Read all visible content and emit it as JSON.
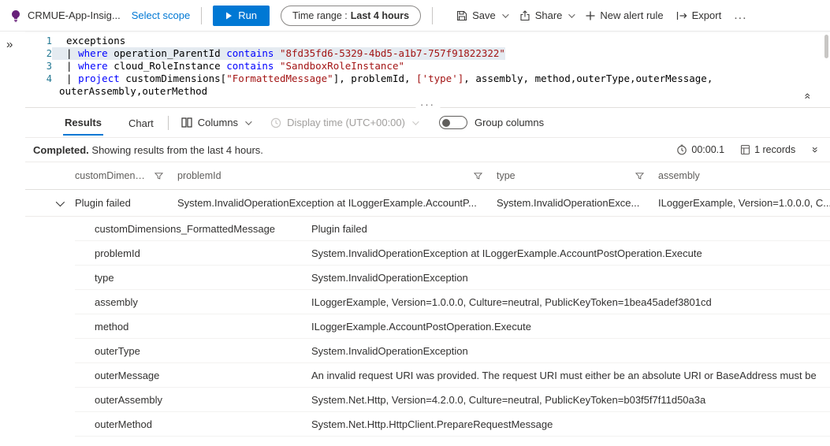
{
  "toolbar": {
    "app_name": "CRMUE-App-Insig...",
    "select_scope": "Select scope",
    "run": "Run",
    "time_range_label": "Time range :",
    "time_range_value": "Last 4 hours",
    "save": "Save",
    "share": "Share",
    "new_alert_rule": "New alert rule",
    "export": "Export",
    "more": "..."
  },
  "icons": {
    "run_play": "▶",
    "expand_rail": "»",
    "double_chevron": "»",
    "plus": "+"
  },
  "editor": {
    "lines": [
      {
        "num": "1",
        "tokens": [
          {
            "t": "exceptions",
            "c": "plain"
          }
        ]
      },
      {
        "num": "2",
        "highlight": true,
        "tokens": [
          {
            "t": "| ",
            "c": "plain"
          },
          {
            "t": "where",
            "c": "kw"
          },
          {
            "t": " operation_ParentId ",
            "c": "plain"
          },
          {
            "t": "contains",
            "c": "kw"
          },
          {
            "t": " ",
            "c": "plain"
          },
          {
            "t": "\"8fd35fd6-5329-4bd5-a1b7-757f91822322\"",
            "c": "str"
          }
        ]
      },
      {
        "num": "3",
        "tokens": [
          {
            "t": "| ",
            "c": "plain"
          },
          {
            "t": "where",
            "c": "kw"
          },
          {
            "t": " cloud_RoleInstance ",
            "c": "plain"
          },
          {
            "t": "contains",
            "c": "kw"
          },
          {
            "t": " ",
            "c": "plain"
          },
          {
            "t": "\"SandboxRoleInstance\"",
            "c": "str"
          }
        ]
      },
      {
        "num": "4",
        "tokens": [
          {
            "t": "| ",
            "c": "plain"
          },
          {
            "t": "project",
            "c": "kw"
          },
          {
            "t": " customDimensions[",
            "c": "plain"
          },
          {
            "t": "\"FormattedMessage\"",
            "c": "str"
          },
          {
            "t": "], problemId, ",
            "c": "plain"
          },
          {
            "t": "['type']",
            "c": "str"
          },
          {
            "t": ", assembly, method,outerType,outerMessage,",
            "c": "plain"
          }
        ]
      },
      {
        "wrap": true,
        "tokens": [
          {
            "t": "outerAssembly,outerMethod",
            "c": "plain"
          }
        ]
      }
    ]
  },
  "tabs": {
    "results": "Results",
    "chart": "Chart",
    "columns": "Columns",
    "display_time": "Display time (UTC+00:00)",
    "group_columns": "Group columns"
  },
  "status": {
    "completed": "Completed.",
    "message": " Showing results from the last 4 hours.",
    "duration": "00:00.1",
    "records": "1 records"
  },
  "table": {
    "headers": [
      "customDimensi...",
      "problemId",
      "type",
      "assembly"
    ],
    "row": {
      "customDimensions": "Plugin failed",
      "problemId": "System.InvalidOperationException at ILoggerExample.AccountP...",
      "type": "System.InvalidOperationExce...",
      "assembly": "ILoggerExample, Version=1.0.0.0, C..."
    },
    "details": [
      {
        "key": "customDimensions_FormattedMessage",
        "value": "Plugin failed"
      },
      {
        "key": "problemId",
        "value": "System.InvalidOperationException at ILoggerExample.AccountPostOperation.Execute"
      },
      {
        "key": "type",
        "value": "System.InvalidOperationException"
      },
      {
        "key": "assembly",
        "value": "ILoggerExample, Version=1.0.0.0, Culture=neutral, PublicKeyToken=1bea45adef3801cd"
      },
      {
        "key": "method",
        "value": "ILoggerExample.AccountPostOperation.Execute"
      },
      {
        "key": "outerType",
        "value": "System.InvalidOperationException"
      },
      {
        "key": "outerMessage",
        "value": "An invalid request URI was provided. The request URI must either be an absolute URI or BaseAddress must be"
      },
      {
        "key": "outerAssembly",
        "value": "System.Net.Http, Version=4.2.0.0, Culture=neutral, PublicKeyToken=b03f5f7f11d50a3a"
      },
      {
        "key": "outerMethod",
        "value": "System.Net.Http.HttpClient.PrepareRequestMessage"
      }
    ]
  }
}
